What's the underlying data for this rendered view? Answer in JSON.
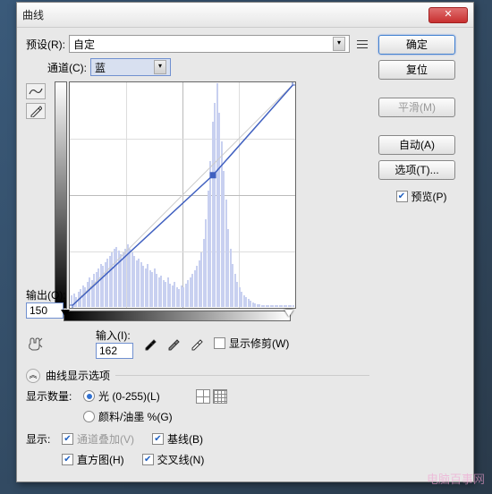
{
  "window": {
    "title": "曲线"
  },
  "preset": {
    "label": "预设(R):",
    "value": "自定"
  },
  "channel": {
    "label": "通道(C):",
    "value": "蓝"
  },
  "output": {
    "label": "输出(O):",
    "value": "150"
  },
  "input": {
    "label": "输入(I):",
    "value": "162"
  },
  "show_clip": {
    "label": "显示修剪(W)"
  },
  "display_options": {
    "header": "曲线显示选项"
  },
  "show_amount": {
    "label": "显示数量:",
    "light": "光 (0-255)(L)",
    "pigment": "颜料/油墨 %(G)"
  },
  "show": {
    "label": "显示:",
    "overlay": "通道叠加(V)",
    "baseline": "基线(B)",
    "histogram": "直方图(H)",
    "intersection": "交叉线(N)"
  },
  "buttons": {
    "ok": "确定",
    "reset": "复位",
    "smooth": "平滑(M)",
    "auto": "自动(A)",
    "options": "选项(T)..."
  },
  "preview": {
    "label": "预览(P)"
  },
  "chart_data": {
    "type": "curve",
    "xlabel": "输入",
    "ylabel": "输出",
    "xlim": [
      0,
      255
    ],
    "ylim": [
      0,
      255
    ],
    "points": [
      {
        "x": 0,
        "y": 0
      },
      {
        "x": 162,
        "y": 150
      },
      {
        "x": 255,
        "y": 255
      }
    ],
    "histogram_approx": [
      12,
      14,
      10,
      16,
      18,
      22,
      20,
      26,
      30,
      28,
      34,
      36,
      40,
      44,
      42,
      46,
      50,
      52,
      56,
      60,
      62,
      58,
      54,
      56,
      60,
      64,
      60,
      56,
      52,
      48,
      50,
      46,
      42,
      40,
      44,
      38,
      36,
      40,
      34,
      30,
      32,
      28,
      26,
      30,
      24,
      22,
      26,
      20,
      18,
      22,
      20,
      24,
      28,
      30,
      34,
      38,
      42,
      48,
      56,
      70,
      90,
      120,
      150,
      190,
      210,
      230,
      200,
      170,
      140,
      110,
      80,
      60,
      44,
      34,
      26,
      20,
      16,
      12,
      10,
      8,
      6,
      5,
      4,
      3,
      3,
      2,
      2,
      2,
      2,
      2,
      2,
      2,
      2,
      2,
      2,
      2,
      2,
      2,
      2,
      2
    ]
  },
  "watermark": "电脑百事网"
}
